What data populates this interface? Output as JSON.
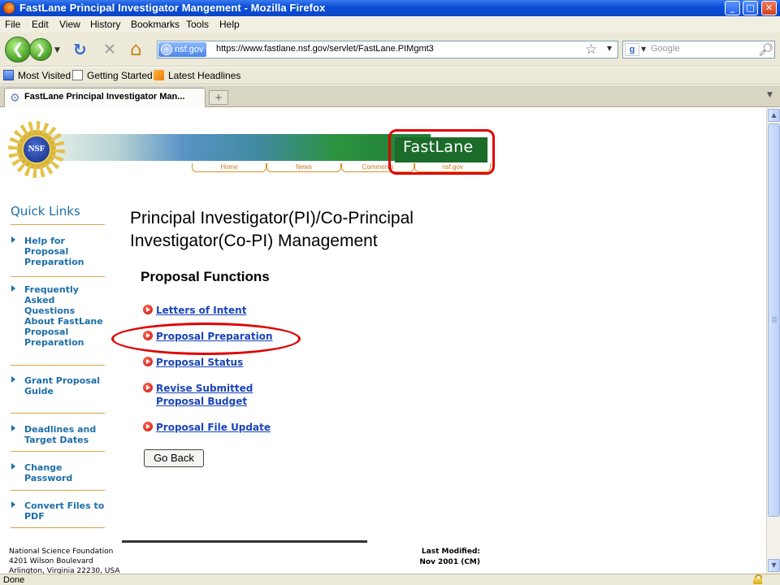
{
  "window": {
    "title": "FastLane Principal Investigator Mangement - Mozilla Firefox",
    "min_glyph": "_",
    "max_glyph": "□",
    "close_glyph": "✕"
  },
  "menu": [
    "File",
    "Edit",
    "View",
    "History",
    "Bookmarks",
    "Tools",
    "Help"
  ],
  "nav": {
    "back_glyph": "❮",
    "forward_glyph": "❯",
    "reload_glyph": "↻",
    "stop_glyph": "✕",
    "home_glyph": "⌂",
    "site_identity": "nsf.gov",
    "url": "https://www.fastlane.nsf.gov/servlet/FastLane.PIMgmt3",
    "search_placeholder": "Google"
  },
  "bookmarks": [
    "Most Visited",
    "Getting Started",
    "Latest Headlines"
  ],
  "tab": {
    "label": "FastLane Principal Investigator Man...",
    "new_tab_glyph": "+"
  },
  "banner": {
    "logo_text": "NSF",
    "brand": "FastLane",
    "tabs": [
      "Home",
      "News",
      "Comments",
      "nsf.gov"
    ]
  },
  "quick_links": {
    "title": "Quick Links",
    "items": [
      "Help for Proposal Preparation",
      "Frequently Asked Questions About FastLane Proposal Preparation",
      "Grant Proposal Guide",
      "Deadlines and Target Dates",
      "Change Password",
      "Convert Files to PDF"
    ]
  },
  "main": {
    "title": "Principal Investigator(PI)/Co-Principal Investigator(Co-PI) Management",
    "section_title": "Proposal Functions",
    "functions": [
      "Letters of Intent",
      "Proposal Preparation",
      "Proposal Status",
      "Revise Submitted Proposal Budget",
      "Proposal File Update"
    ],
    "go_back": "Go Back"
  },
  "footer": {
    "org": "National Science Foundation",
    "address1": "4201 Wilson Boulevard",
    "address2": "Arlington, Virginia 22230, USA",
    "last_modified_label": "Last Modified:",
    "last_modified_value": "Nov 2001 (CM)"
  },
  "status": {
    "text": "Done"
  },
  "colors": {
    "link": "#1a44b8",
    "quick_link": "#1d6ea8",
    "annotation": "#e00000",
    "fastlane_green": "#1c6b2a",
    "banner_tab": "#d8912c"
  }
}
